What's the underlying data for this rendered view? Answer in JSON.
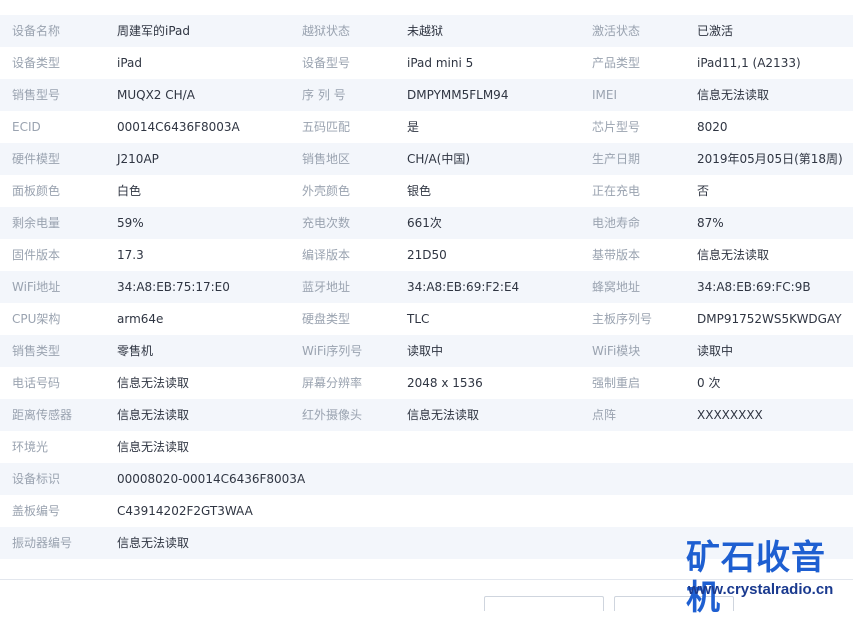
{
  "rows": [
    {
      "l1": "设备名称",
      "v1": "周建军的iPad",
      "l2": "越狱状态",
      "v2": "未越狱",
      "l3": "激活状态",
      "v3": "已激活"
    },
    {
      "l1": "设备类型",
      "v1": "iPad",
      "l2": "设备型号",
      "v2": "iPad mini 5",
      "l3": "产品类型",
      "v3": "iPad11,1 (A2133)"
    },
    {
      "l1": "销售型号",
      "v1": "MUQX2 CH/A",
      "l2": "序 列 号",
      "v2": "DMPYMM5FLM94",
      "l3": "IMEI",
      "v3": "信息无法读取"
    },
    {
      "l1": "ECID",
      "v1": "00014C6436F8003A",
      "l2": "五码匹配",
      "v2": "是",
      "l3": "芯片型号",
      "v3": "8020"
    },
    {
      "l1": "硬件模型",
      "v1": "J210AP",
      "l2": "销售地区",
      "v2": "CH/A(中国)",
      "l3": "生产日期",
      "v3": "2019年05月05日(第18周)"
    },
    {
      "l1": "面板颜色",
      "v1": "白色",
      "l2": "外壳颜色",
      "v2": "银色",
      "l3": "正在充电",
      "v3": "否"
    },
    {
      "l1": "剩余电量",
      "v1": "59%",
      "l2": "充电次数",
      "v2": "661次",
      "l3": "电池寿命",
      "v3": "87%"
    },
    {
      "l1": "固件版本",
      "v1": "17.3",
      "l2": "编译版本",
      "v2": "21D50",
      "l3": "基带版本",
      "v3": "信息无法读取"
    },
    {
      "l1": "WiFi地址",
      "v1": "34:A8:EB:75:17:E0",
      "l2": "蓝牙地址",
      "v2": "34:A8:EB:69:F2:E4",
      "l3": "蜂窝地址",
      "v3": "34:A8:EB:69:FC:9B"
    },
    {
      "l1": "CPU架构",
      "v1": "arm64e",
      "l2": "硬盘类型",
      "v2": "TLC",
      "l3": "主板序列号",
      "v3": "DMP91752WS5KWDGAY"
    },
    {
      "l1": "销售类型",
      "v1": "零售机",
      "l2": "WiFi序列号",
      "v2": "读取中",
      "l3": "WiFi模块",
      "v3": "读取中"
    },
    {
      "l1": "电话号码",
      "v1": "信息无法读取",
      "l2": "屏幕分辨率",
      "v2": "2048 x 1536",
      "l3": "强制重启",
      "v3": "0 次"
    },
    {
      "l1": "距离传感器",
      "v1": "信息无法读取",
      "l2": "红外摄像头",
      "v2": "信息无法读取",
      "l3": "点阵",
      "v3": "XXXXXXXX"
    },
    {
      "l1": "环境光",
      "v1": "信息无法读取"
    },
    {
      "l1": "设备标识",
      "v1": "00008020-00014C6436F8003A"
    },
    {
      "l1": "盖板编号",
      "v1": "C43914202F2GT3WAA"
    },
    {
      "l1": "振动器编号",
      "v1": "信息无法读取"
    }
  ],
  "watermark": {
    "name": "矿石收音机",
    "url": "www.crystalradio.cn"
  }
}
